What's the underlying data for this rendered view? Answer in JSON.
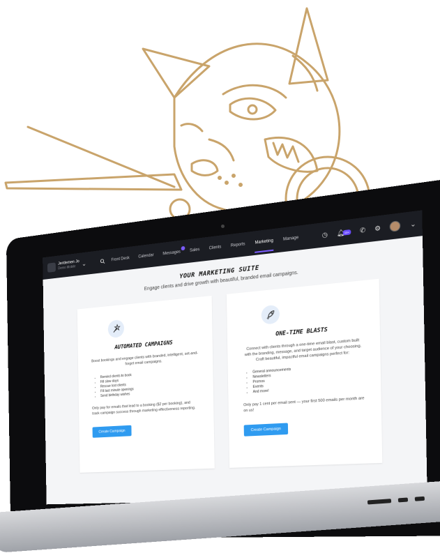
{
  "brand": {
    "name": "Jentlemen Jo",
    "subtitle": "Demo Mobile"
  },
  "nav": {
    "items": [
      {
        "label": "Front Desk"
      },
      {
        "label": "Calendar"
      },
      {
        "label": "Messages"
      },
      {
        "label": "Sales"
      },
      {
        "label": "Clients"
      },
      {
        "label": "Reports"
      },
      {
        "label": "Marketing"
      },
      {
        "label": "Manage"
      }
    ],
    "active": "Marketing",
    "notification_badge": "10+"
  },
  "main": {
    "title": "YOUR MARKETING SUITE",
    "subtitle": "Engage clients and drive growth with beautiful, branded email campaigns."
  },
  "cards": [
    {
      "icon": "magic-wand-icon",
      "title": "AUTOMATED CAMPAIGNS",
      "description": "Boost bookings and engage clients with branded, intelligent, set-and-forget email campaigns.",
      "list": [
        "Remind clients to book",
        "Fill slow days",
        "Rescue lost clients",
        "Fill last minute openings",
        "Send birthday wishes"
      ],
      "note": "Only pay for emails that lead to a booking ($2 per booking), and track campaign success through marketing effectiveness reporting.",
      "button": "Create Campaign"
    },
    {
      "icon": "rocket-icon",
      "title": "ONE-TIME BLASTS",
      "description": "Connect with clients through a one-time email blast, custom built with the branding, message, and target audience of your choosing. Craft beautiful, impactful email campaigns perfect for:",
      "list": [
        "General announcements",
        "Newsletters",
        "Promos",
        "Events",
        "And more!"
      ],
      "note": "Only pay 1 cent per email sent — your first 500 emails per month are on us!",
      "button": "Create Campaign"
    }
  ],
  "colors": {
    "illustration": "#c9a46b",
    "accent": "#7b5cff",
    "button": "#2f9bf0",
    "nav_bg": "#1b1d23"
  }
}
